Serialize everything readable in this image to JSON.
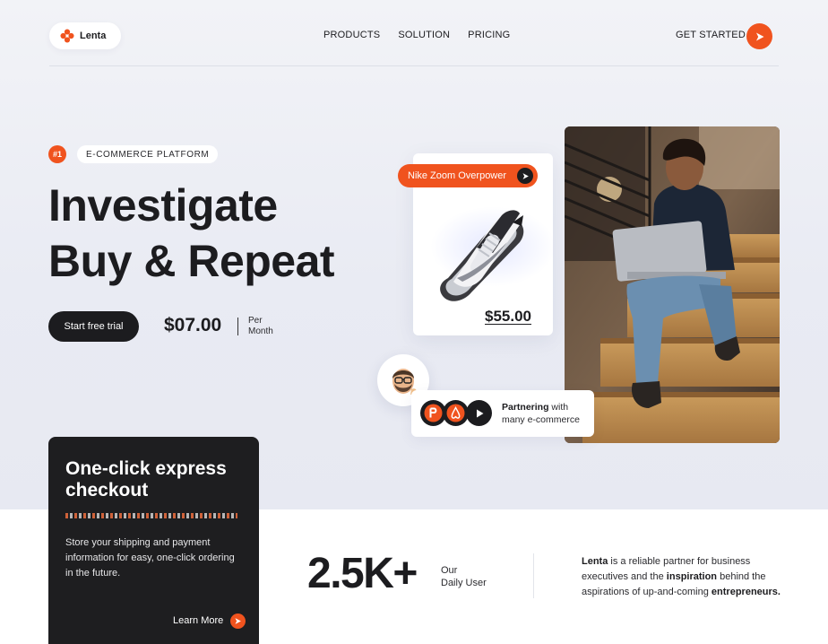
{
  "brand": {
    "name": "Lenta",
    "accent_color": "#f0531e",
    "dark_color": "#1c1c1f"
  },
  "nav": {
    "items": [
      {
        "label": "PRODUCTS"
      },
      {
        "label": "SOLUTION"
      },
      {
        "label": "PRICING"
      }
    ],
    "cta_label": "GET STARTED",
    "cta_icon": "arrow-right-icon"
  },
  "hero": {
    "badge_number": "#1",
    "badge_label": "E-COMMERCE PLATFORM",
    "title_line1": "Investigate",
    "title_line2": "Buy & Repeat",
    "trial_button": "Start free trial",
    "price": "$07.00",
    "price_period_line1": "Per",
    "price_period_line2": "Month"
  },
  "product": {
    "name": "Nike Zoom Overpower",
    "price": "$55.00",
    "image": "sneaker-image"
  },
  "partner": {
    "bold": "Partnering",
    "text1": " with",
    "text2": "many e-commerce",
    "logos": [
      "producthunt-logo-icon",
      "airbnb-logo-icon",
      "play-logo-icon"
    ]
  },
  "checkout": {
    "title": "One-click express checkout",
    "description": "Store your shipping and payment information for easy, one-click ordering in the future.",
    "link_label": "Learn More"
  },
  "stats": {
    "number": "2.5K+",
    "label_line1": "Our",
    "label_line2": "Daily User"
  },
  "about": {
    "brand": "Lenta",
    "text1": " is a reliable partner for business executives and the ",
    "highlight1": "inspiration",
    "text2": " behind the aspirations of up-and-coming ",
    "highlight2": "entrepreneurs."
  }
}
